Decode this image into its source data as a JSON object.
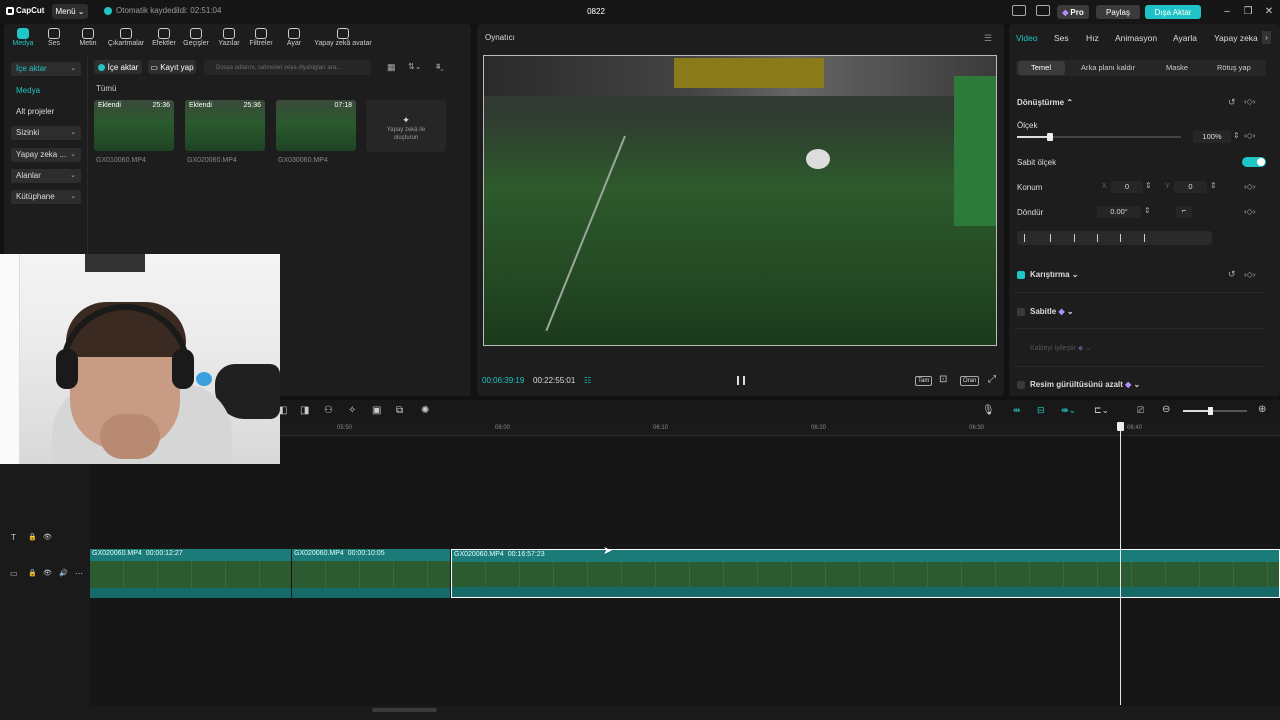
{
  "app": {
    "logo_text": "CapCut",
    "menu_label": "Menü",
    "autosave_text": "Otomatik kaydedildi: 02:51:04",
    "project_title": "0822",
    "pro_label": "Pro",
    "share_label": "Paylaş",
    "export_label": "Dışa Aktar",
    "accent_color": "#1fc2c6"
  },
  "toolbar": {
    "tools": [
      "Medya",
      "Ses",
      "Metin",
      "Çıkartmalar",
      "Efektler",
      "Geçişler",
      "Yazılar",
      "Filtreler",
      "Ayar",
      "Yapay zekâ avatar"
    ],
    "active_tool": "Medya"
  },
  "media_sidebar": {
    "items": [
      {
        "label": "İçe aktar",
        "chevron": "⌄"
      },
      {
        "label": "Medya",
        "chevron": ""
      },
      {
        "label": "Alt projeler",
        "chevron": ""
      },
      {
        "label": "Sizinki",
        "chevron": "⌄"
      },
      {
        "label": "Yapay zeka ...",
        "chevron": "⌄"
      },
      {
        "label": "Alanlar",
        "chevron": "⌄"
      },
      {
        "label": "Kütüphane",
        "chevron": "⌄"
      }
    ]
  },
  "media": {
    "import_label": "İçe aktar",
    "record_label": "Kayıt yap",
    "search_placeholder": "Dosya adlarını, sahneleri veya diyalogları ara...",
    "all_label": "Tümü",
    "items": [
      {
        "tag": "Eklendi",
        "duration": "25:36",
        "name": "GX010060.MP4"
      },
      {
        "tag": "Eklendi",
        "duration": "25:36",
        "name": "GX020060.MP4"
      },
      {
        "tag": "",
        "duration": "07:18",
        "name": "GX030060.MP4"
      }
    ],
    "ai_card_line1": "Yapay zekâ ile",
    "ai_card_line2": "oluşturun"
  },
  "player": {
    "title": "Oynatıcı",
    "current_time": "00:06:39:19",
    "total_time": "00:22:55:01",
    "btn_full": "Tam",
    "btn_ratio": "Oran"
  },
  "properties": {
    "tabs": [
      "Video",
      "Ses",
      "Hız",
      "Animasyon",
      "Ayarla",
      "Yapay zeka"
    ],
    "active_tab": "Video",
    "subtabs": [
      "Temel",
      "Arka planı kaldır",
      "Maske",
      "Rötuş yap"
    ],
    "transform_label": "Dönüştürme",
    "scale_label": "Ölçek",
    "scale_value": "100%",
    "scale_fraction": 0.2,
    "uniform_scale_label": "Sabit ölçek",
    "position_label": "Konum",
    "pos_x_label": "X",
    "pos_x": "0",
    "pos_y_label": "Y",
    "pos_y": "0",
    "rotate_label": "Döndür",
    "rotate_value": "0.00°",
    "blend_label": "Karıştırma",
    "stabilize_label": "Sabitle",
    "enhance_label": "Kaliteyi iyileştir",
    "denoise_label": "Resim gürültüsünü azalt"
  },
  "timeline": {
    "ticks": [
      "05:50",
      "06:00",
      "06:10",
      "06:20",
      "06:30",
      "06:40"
    ],
    "clips": [
      {
        "name": "GX020060.MP4",
        "duration": "00:00:12:27"
      },
      {
        "name": "GX020060.MP4",
        "duration": "00:00:10:05"
      },
      {
        "name": "GX020060.MP4",
        "duration": "00:16:57:23"
      }
    ]
  }
}
